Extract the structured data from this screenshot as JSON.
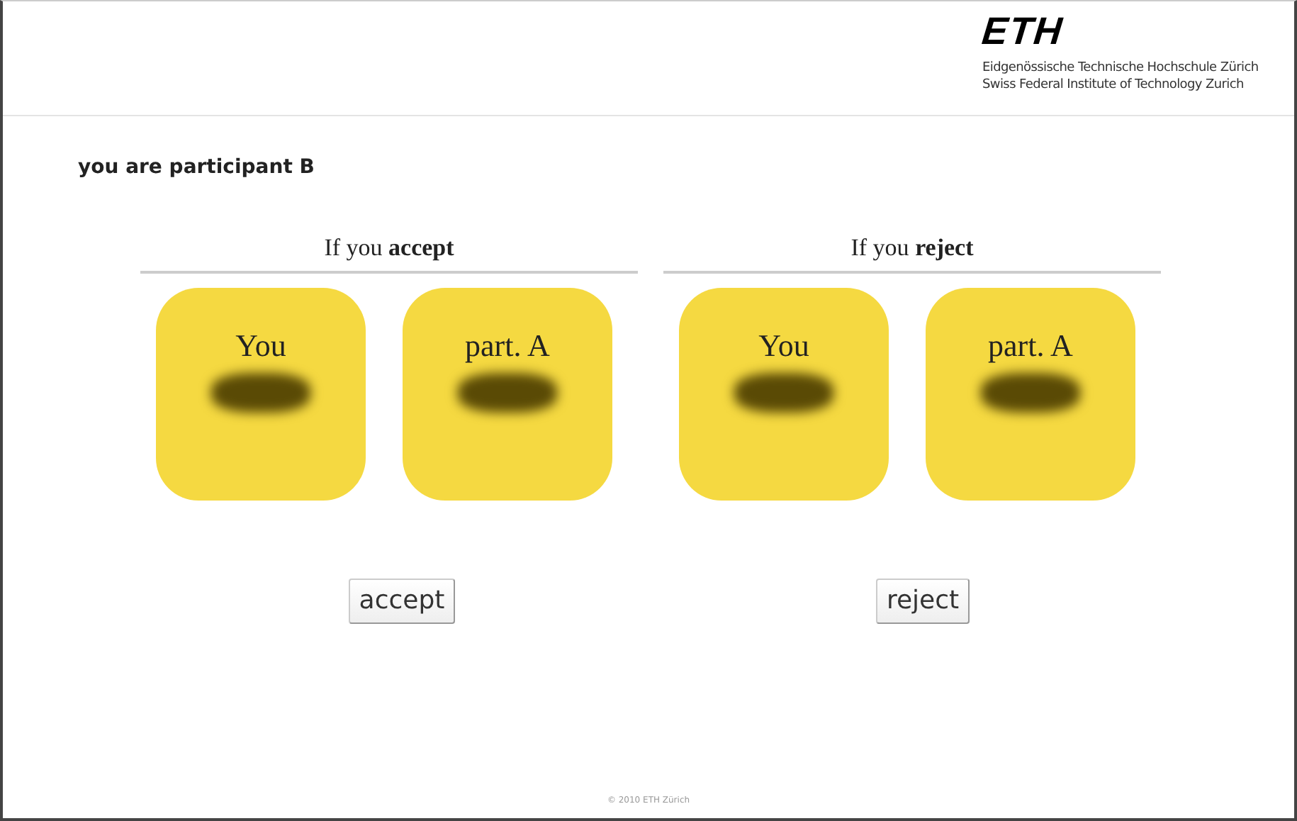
{
  "header": {
    "logo": "ETH",
    "institution_lines": [
      "Eidgenössische Technische Hochschule Zürich",
      "Swiss Federal Institute of Technology Zurich"
    ]
  },
  "role": "you are participant B",
  "options": [
    {
      "heading": "If you **accept**",
      "cards": [
        {
          "label": "You",
          "value_redacted": true
        },
        {
          "label": "part. A",
          "value_redacted": true
        }
      ],
      "button": "accept"
    },
    {
      "heading": "If you **reject**",
      "cards": [
        {
          "label": "You",
          "value_redacted": true
        },
        {
          "label": "part. A",
          "value_redacted": true
        }
      ],
      "button": "reject"
    }
  ],
  "footer": "© 2010 ETH Zürich"
}
